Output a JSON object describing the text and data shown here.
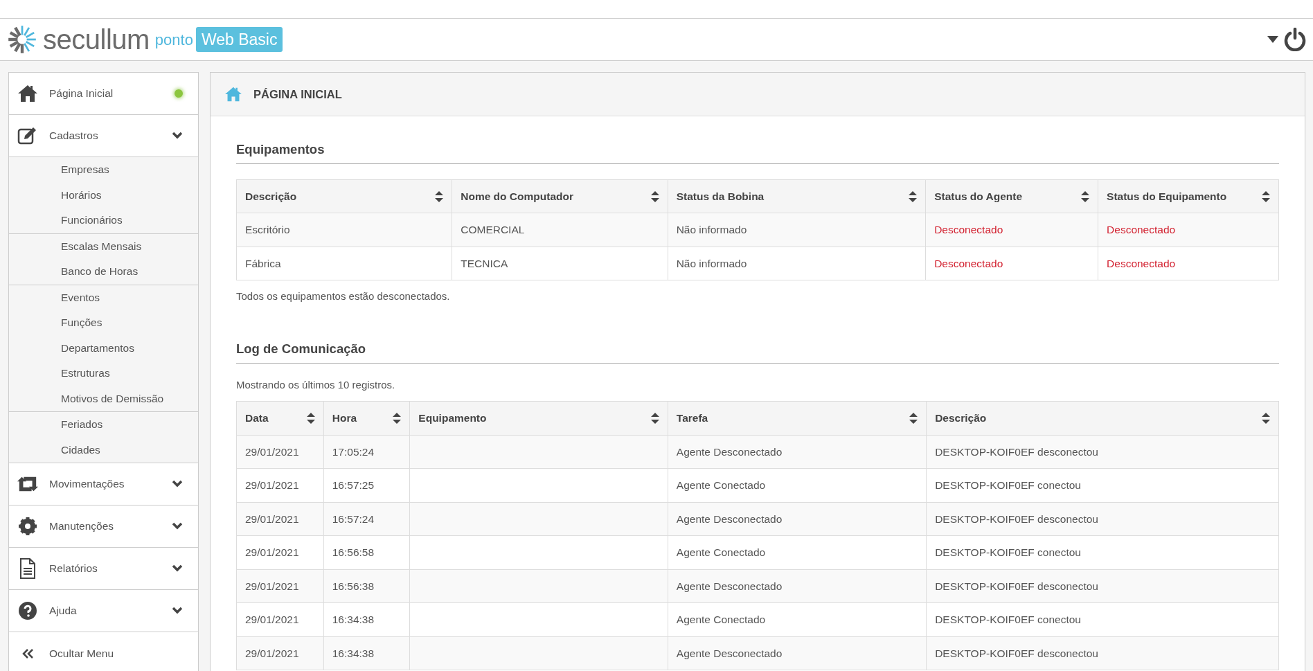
{
  "header": {
    "brand": "secullum",
    "product": "ponto",
    "edition": "Web Basic"
  },
  "sidebar": {
    "items": [
      {
        "kind": "home",
        "label": "Página Inicial",
        "color": "#8cc63f"
      },
      {
        "kind": "edit",
        "label": "Cadastros",
        "submenu": true,
        "groups": [
          [
            "Empresas",
            "Horários",
            "Funcionários"
          ],
          [
            "Escalas Mensais",
            "Banco de Horas"
          ],
          [
            "Eventos",
            "Funções",
            "Departamentos",
            "Estruturas",
            "Motivos de Demissão"
          ],
          [
            "Feriados",
            "Cidades"
          ]
        ]
      },
      {
        "kind": "transfer",
        "label": "Movimentações",
        "submenu": true
      },
      {
        "kind": "gear",
        "label": "Manutenções",
        "submenu": true
      },
      {
        "kind": "document",
        "label": "Relatórios",
        "submenu": true
      },
      {
        "kind": "help",
        "label": "Ajuda",
        "submenu": true
      },
      {
        "kind": "collapse",
        "label": "Ocultar Menu"
      }
    ]
  },
  "page": {
    "title": "PÁGINA INICIAL",
    "equipment": {
      "title": "Equipamentos",
      "columns": [
        "Descrição",
        "Nome do Computador",
        "Status da Bobina",
        "Status do Agente",
        "Status do Equipamento"
      ],
      "rows": [
        {
          "cells": [
            "Escritório",
            "COMERCIAL",
            "Não informado",
            {
              "text": "Desconectado",
              "connected": false
            },
            {
              "text": "Desconectado",
              "connected": false
            }
          ]
        },
        {
          "cells": [
            "Fábrica",
            "TECNICA",
            "Não informado",
            {
              "text": "Desconectado",
              "connected": false
            },
            {
              "text": "Desconectado",
              "connected": false
            }
          ]
        }
      ],
      "note": "Todos os equipamentos estão desconectados."
    },
    "log": {
      "title": "Log de Comunicação",
      "note": "Mostrando os últimos 10 registros.",
      "columns": [
        "Data",
        "Hora",
        "Equipamento",
        "Tarefa",
        "Descrição"
      ],
      "rows": [
        [
          "29/01/2021",
          "17:05:24",
          "",
          "Agente Desconectado",
          "DESKTOP-KOIF0EF desconectou"
        ],
        [
          "29/01/2021",
          "16:57:25",
          "",
          "Agente Conectado",
          "DESKTOP-KOIF0EF conectou"
        ],
        [
          "29/01/2021",
          "16:57:24",
          "",
          "Agente Desconectado",
          "DESKTOP-KOIF0EF desconectou"
        ],
        [
          "29/01/2021",
          "16:56:58",
          "",
          "Agente Conectado",
          "DESKTOP-KOIF0EF conectou"
        ],
        [
          "29/01/2021",
          "16:56:38",
          "",
          "Agente Desconectado",
          "DESKTOP-KOIF0EF desconectou"
        ],
        [
          "29/01/2021",
          "16:34:38",
          "",
          "Agente Conectado",
          "DESKTOP-KOIF0EF conectou"
        ],
        [
          "29/01/2021",
          "16:34:38",
          "",
          "Agente Desconectado",
          "DESKTOP-KOIF0EF desconectou"
        ]
      ]
    }
  }
}
